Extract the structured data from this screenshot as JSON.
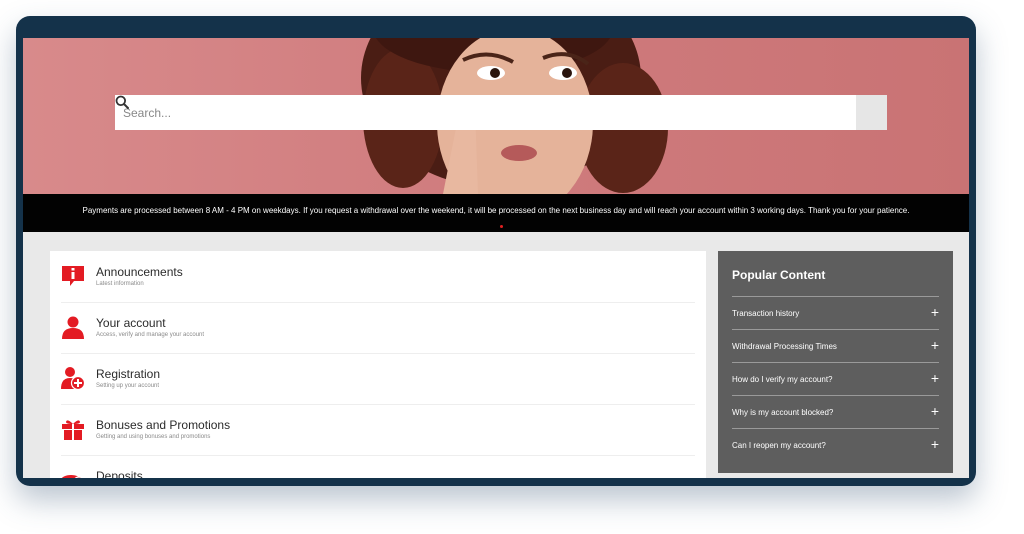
{
  "search": {
    "placeholder": "Search..."
  },
  "notice": {
    "text": "Payments are processed between 8 AM - 4 PM on weekdays. If you request a withdrawal over the weekend, it will be processed on the next business day and will reach your account within 3 working days. Thank you for your patience."
  },
  "categories": [
    {
      "title": "Announcements",
      "subtitle": "Latest information",
      "icon": "info-bubble-icon"
    },
    {
      "title": "Your account",
      "subtitle": "Access, verify and manage your account",
      "icon": "user-icon"
    },
    {
      "title": "Registration",
      "subtitle": "Setting up your account",
      "icon": "user-plus-icon"
    },
    {
      "title": "Bonuses and Promotions",
      "subtitle": "Getting and using bonuses and promotions",
      "icon": "gift-icon"
    },
    {
      "title": "Deposits",
      "subtitle": "",
      "icon": "deposit-icon"
    }
  ],
  "popular": {
    "title": "Popular Content",
    "items": [
      "Transaction history",
      "Withdrawal Processing Times",
      "How do I verify my account?",
      "Why is my account blocked?",
      "Can I reopen my account?"
    ]
  },
  "colors": {
    "accent": "#e31b23",
    "frame": "#14324a",
    "hero": "#cf7b7d",
    "notice_bg": "#020202",
    "sidebar_bg": "#5e5e5e"
  }
}
